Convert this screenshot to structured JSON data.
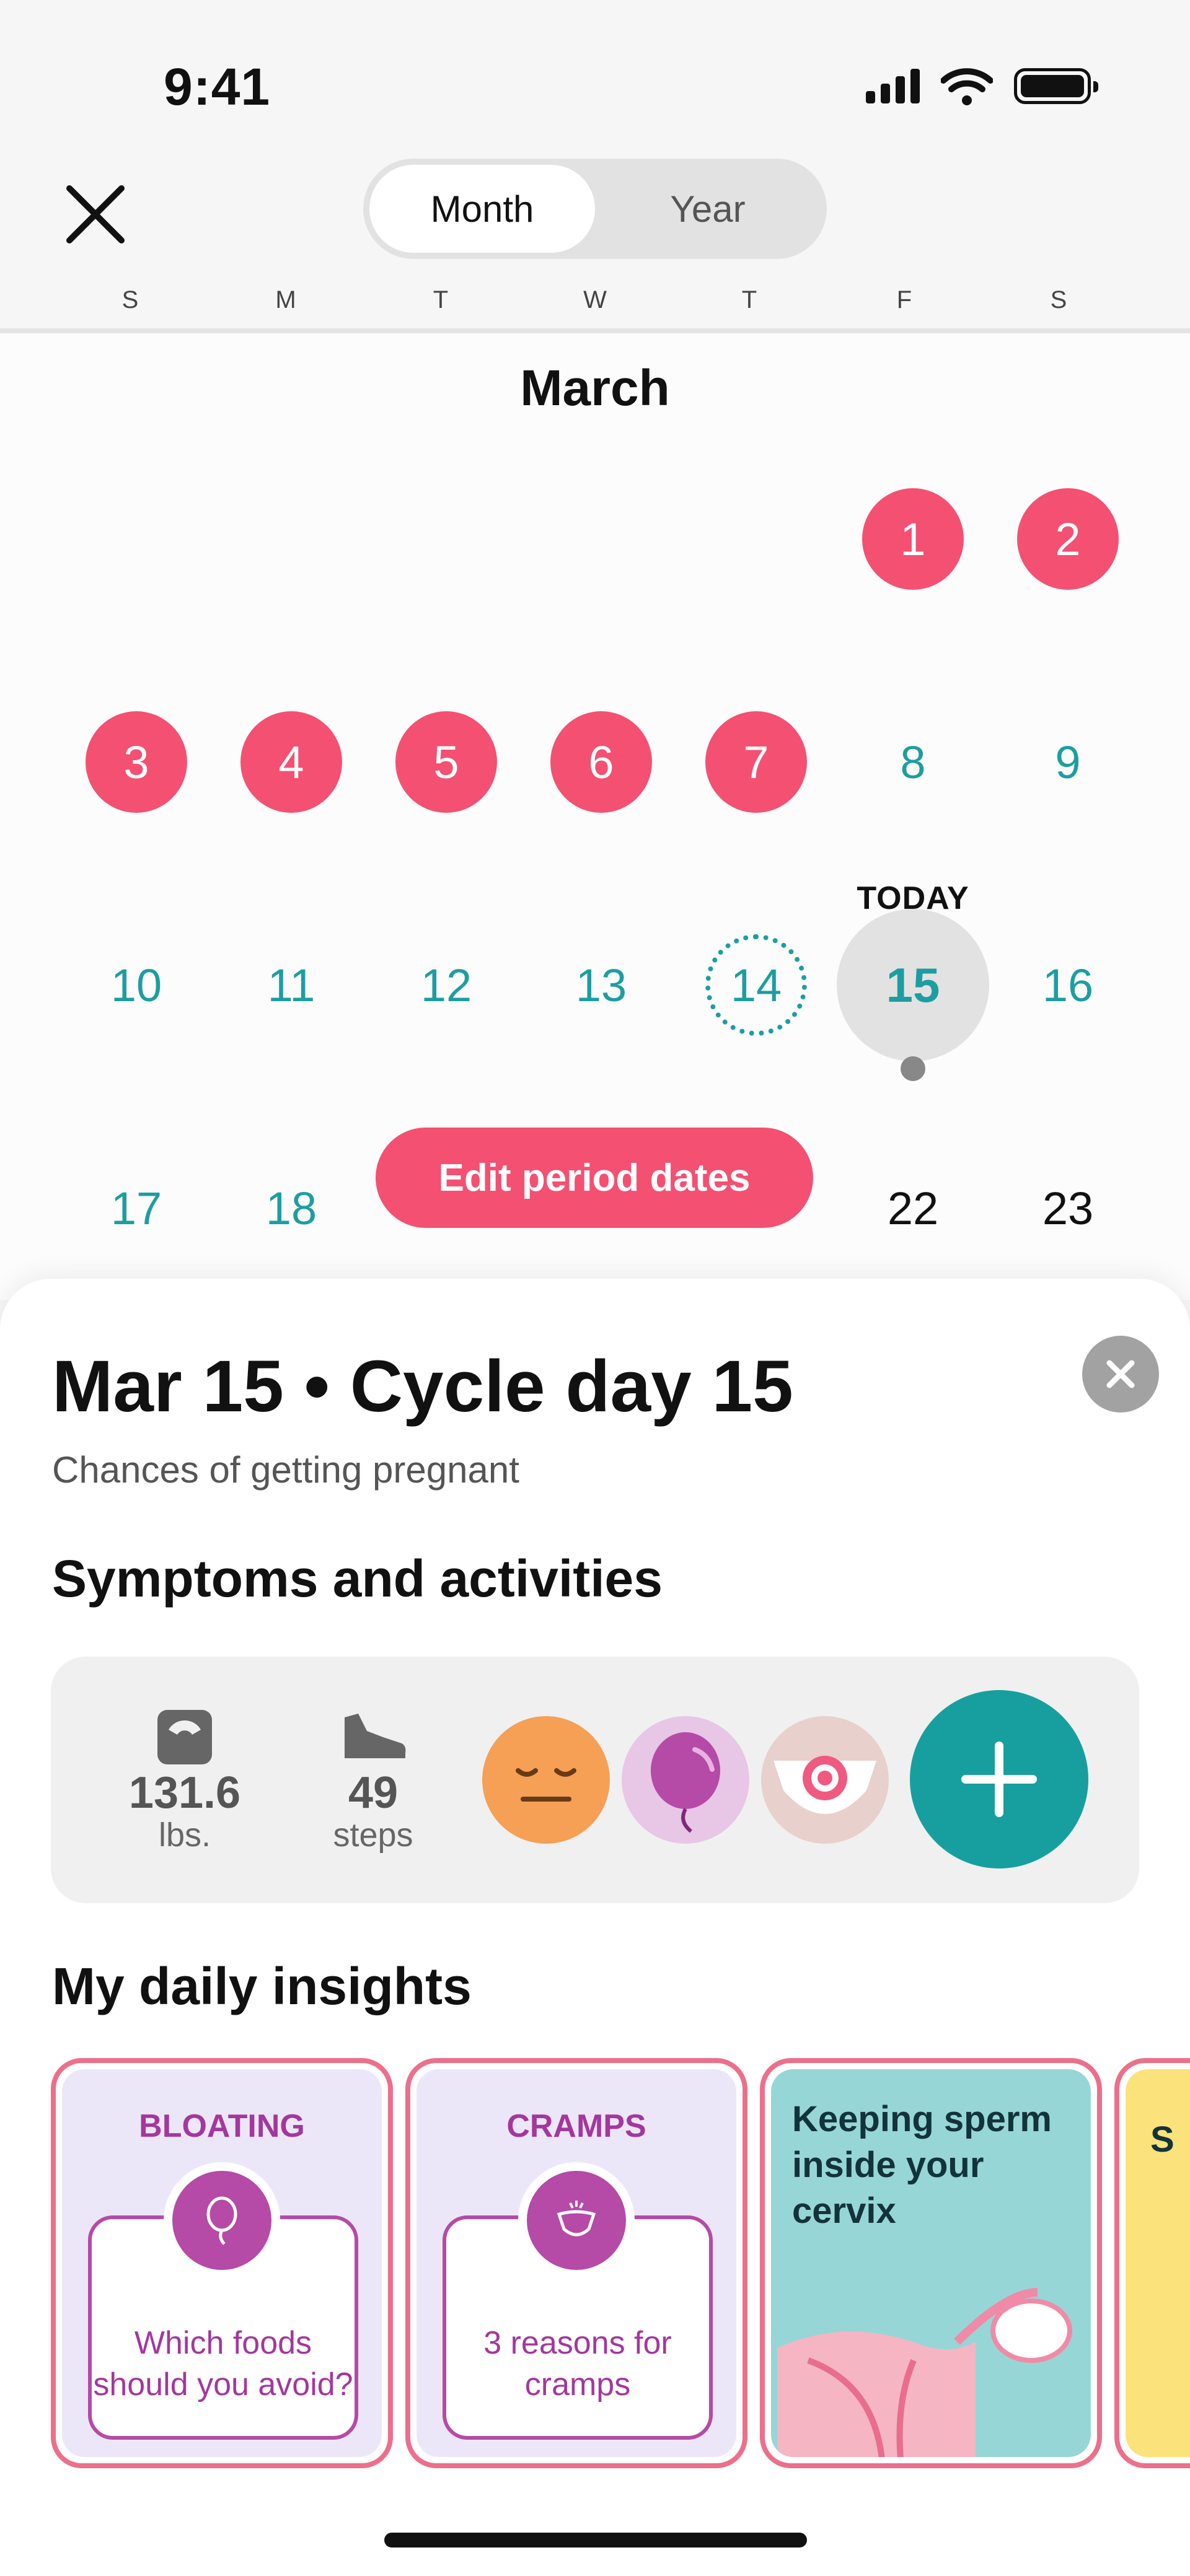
{
  "status_bar": {
    "time": "9:41"
  },
  "header": {
    "segment": {
      "month": "Month",
      "year": "Year",
      "selected": "Month"
    }
  },
  "weekdays": [
    "S",
    "M",
    "T",
    "W",
    "T",
    "F",
    "S"
  ],
  "calendar": {
    "month": "March",
    "today_label": "TODAY",
    "days": [
      {
        "n": "1",
        "state": "period"
      },
      {
        "n": "2",
        "state": "period"
      },
      {
        "n": "3",
        "state": "period"
      },
      {
        "n": "4",
        "state": "period"
      },
      {
        "n": "5",
        "state": "period"
      },
      {
        "n": "6",
        "state": "period"
      },
      {
        "n": "7",
        "state": "period"
      },
      {
        "n": "8",
        "state": "fertile"
      },
      {
        "n": "9",
        "state": "fertile"
      },
      {
        "n": "10",
        "state": "fertile"
      },
      {
        "n": "11",
        "state": "fertile"
      },
      {
        "n": "12",
        "state": "fertile"
      },
      {
        "n": "13",
        "state": "fertile"
      },
      {
        "n": "14",
        "state": "ovulation"
      },
      {
        "n": "15",
        "state": "today"
      },
      {
        "n": "16",
        "state": "fertile"
      },
      {
        "n": "17",
        "state": "fertile"
      },
      {
        "n": "18",
        "state": "fertile"
      },
      {
        "n": "22",
        "state": "plain"
      },
      {
        "n": "23",
        "state": "plain"
      }
    ],
    "edit_button": "Edit period dates"
  },
  "sheet": {
    "title": "Mar 15 • Cycle day 15",
    "subtitle": "Chances of getting pregnant",
    "symptoms_heading": "Symptoms and activities",
    "tracking": {
      "weight_value": "131.6",
      "weight_unit": "lbs.",
      "steps_value": "49",
      "steps_unit": "steps",
      "logged_icons": [
        "calm-mood-icon",
        "bloating-balloon-icon",
        "discharge-icon"
      ]
    },
    "insights_heading": "My daily insights",
    "insights": [
      {
        "tag": "BLOATING",
        "text": "Which foods should you avoid?",
        "icon": "balloon-icon"
      },
      {
        "tag": "CRAMPS",
        "text": "3 reasons for cramps",
        "icon": "cramps-icon"
      },
      {
        "tag": "",
        "text": "Keeping sperm inside your cervix",
        "icon": "uterus-illustration"
      }
    ],
    "partial_card_text": "S"
  },
  "colors": {
    "period": "#f45072",
    "fertile": "#1c9ea1",
    "accent_card": "#ec6f8b",
    "insight_purple": "#a4379d"
  }
}
